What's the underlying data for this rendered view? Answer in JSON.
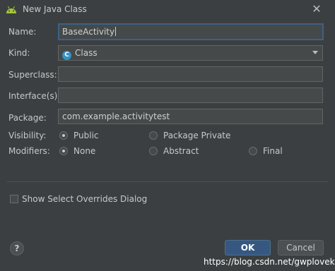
{
  "window": {
    "title": "New Java Class",
    "icon": "android-icon",
    "close": "✕"
  },
  "form": {
    "name": {
      "label": "Name:",
      "value": "BaseActivity"
    },
    "kind": {
      "label": "Kind:",
      "value": "Class",
      "icon": "class-icon",
      "icon_letter": "C"
    },
    "superclass": {
      "label": "Superclass:",
      "value": ""
    },
    "interfaces": {
      "label": "Interface(s):",
      "value": ""
    },
    "package": {
      "label": "Package:",
      "value": "com.example.activitytest"
    },
    "visibility": {
      "label": "Visibility:",
      "options": [
        {
          "label": "Public",
          "selected": true
        },
        {
          "label": "Package Private",
          "selected": false
        }
      ]
    },
    "modifiers": {
      "label": "Modifiers:",
      "options": [
        {
          "label": "None",
          "selected": true
        },
        {
          "label": "Abstract",
          "selected": false
        },
        {
          "label": "Final",
          "selected": false
        }
      ]
    }
  },
  "show_overrides": {
    "label": "Show Select Overrides Dialog",
    "checked": false
  },
  "buttons": {
    "help": "?",
    "ok": "OK",
    "cancel": "Cancel"
  },
  "watermark": "https://blog.csdn.net/gwplovekimi",
  "colors": {
    "background": "#3c3f41",
    "field": "#45494a",
    "focus_border": "#3d6185",
    "ok_button": "#365880",
    "class_icon": "#3592c4"
  }
}
